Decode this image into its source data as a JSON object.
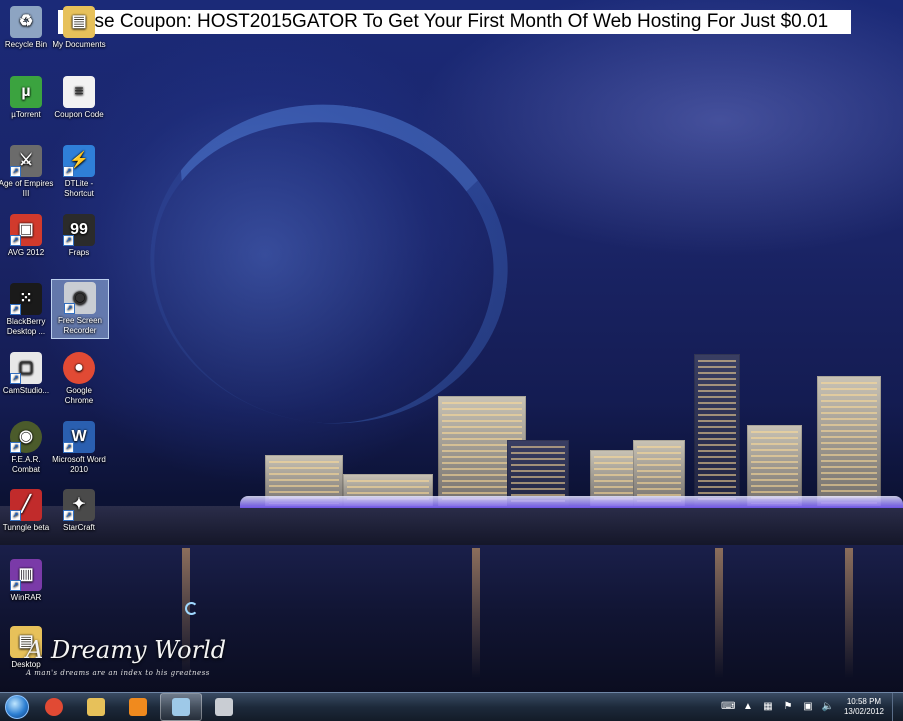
{
  "banner": {
    "text": "Use Coupon: HOST2015GATOR To Get Your First Month Of Web Hosting For Just $0.01"
  },
  "desktop_icons": [
    {
      "label": "Recycle Bin",
      "icon": "recycle-bin-icon",
      "color": "#8da4c2",
      "glyph": "♻"
    },
    {
      "label": "My Documents",
      "icon": "folder-icon",
      "color": "#e7c15a",
      "glyph": "▤"
    },
    {
      "label": "µTorrent",
      "icon": "utorrent-icon",
      "color": "#3ba33f",
      "glyph": "µ"
    },
    {
      "label": "Coupon Code",
      "icon": "text-document-icon",
      "color": "#f2f2f2",
      "glyph": "≡"
    },
    {
      "label": "Age of Empires III",
      "icon": "age-of-empires-icon",
      "color": "#6b6b6b",
      "glyph": "⚔"
    },
    {
      "label": "DTLite - Shortcut",
      "icon": "daemon-tools-icon",
      "color": "#2f7fd8",
      "glyph": "⚡"
    },
    {
      "label": "AVG 2012",
      "icon": "avg-icon",
      "color": "#d13a2c",
      "glyph": "▣"
    },
    {
      "label": "Fraps",
      "icon": "fraps-icon",
      "color": "#2b2b2b",
      "glyph": "99"
    },
    {
      "label": "BlackBerry Desktop ...",
      "icon": "blackberry-icon",
      "color": "#1a1a1a",
      "glyph": "⁙"
    },
    {
      "label": "Free Screen Recorder",
      "icon": "camera-icon",
      "color": "#c9cdd3",
      "glyph": "◉"
    },
    {
      "label": "CamStudio...",
      "icon": "camstudio-icon",
      "color": "#e8e8e8",
      "glyph": "▢"
    },
    {
      "label": "Google Chrome",
      "icon": "chrome-icon",
      "color": "#e14a34",
      "glyph": "●"
    },
    {
      "label": "F.E.A.R. Combat",
      "icon": "fear-combat-icon",
      "color": "#4b5b2b",
      "glyph": "◉"
    },
    {
      "label": "Microsoft Word 2010",
      "icon": "word-icon",
      "color": "#2a5fb0",
      "glyph": "W"
    },
    {
      "label": "Tunngle beta",
      "icon": "tunngle-icon",
      "color": "#c12b2b",
      "glyph": "╱"
    },
    {
      "label": "StarCraft",
      "icon": "starcraft-icon",
      "color": "#4a4a4a",
      "glyph": "✦"
    },
    {
      "label": "WinRAR",
      "icon": "winrar-icon",
      "color": "#7a3aa8",
      "glyph": "▥"
    },
    {
      "label": "Desktop",
      "icon": "desktop-folder-icon",
      "color": "#e7c15a",
      "glyph": "▤"
    }
  ],
  "watermark": {
    "title": "A Dreamy World",
    "subtitle": "A man's dreams are an index to his greatness"
  },
  "taskbar": {
    "items": [
      {
        "name": "chrome",
        "icon": "chrome-icon",
        "color": "#e14a34"
      },
      {
        "name": "explorer",
        "icon": "folder-icon",
        "color": "#e7c15a"
      },
      {
        "name": "media-player",
        "icon": "media-player-icon",
        "color": "#f08a1e"
      },
      {
        "name": "active-window",
        "icon": "window-icon",
        "color": "#9ec9e8"
      },
      {
        "name": "screen-recorder",
        "icon": "camera-icon",
        "color": "#c9cdd3"
      }
    ],
    "active_index": 3,
    "clock": {
      "time": "10:58 PM",
      "date": "13/02/2012"
    }
  }
}
